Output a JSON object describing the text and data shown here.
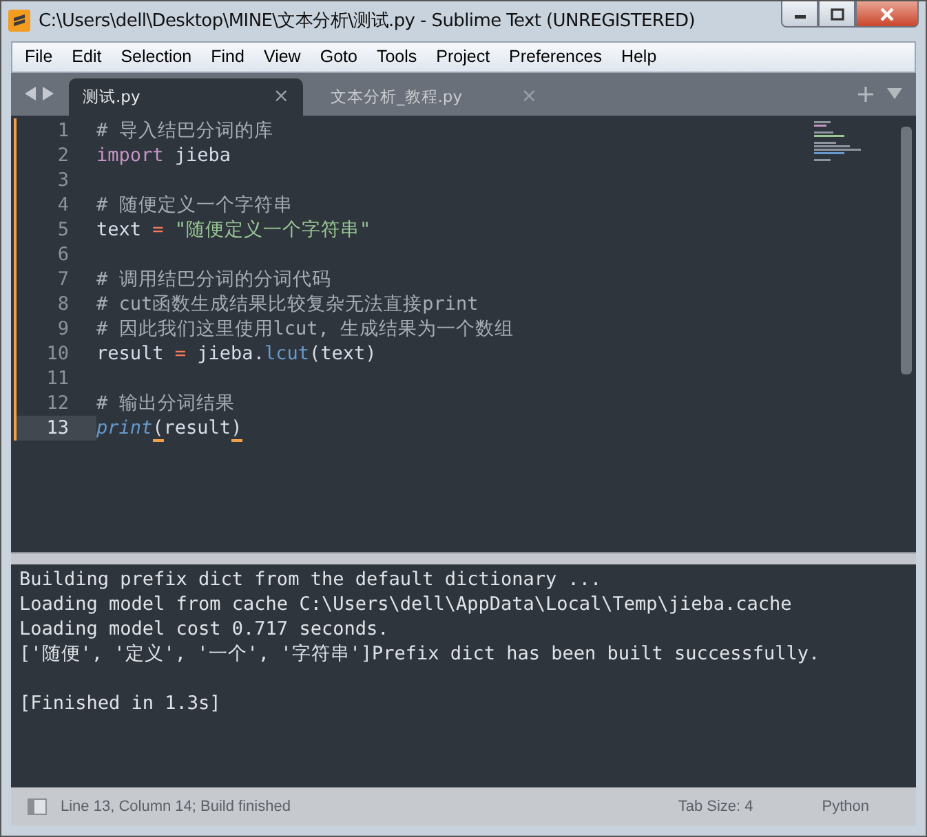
{
  "window": {
    "title": "C:\\Users\\dell\\Desktop\\MINE\\文本分析\\测试.py - Sublime Text (UNREGISTERED)"
  },
  "menu": [
    "File",
    "Edit",
    "Selection",
    "Find",
    "View",
    "Goto",
    "Tools",
    "Project",
    "Preferences",
    "Help"
  ],
  "tabs": [
    {
      "label": "测试.py",
      "selected": true,
      "close": "×"
    },
    {
      "label": "文本分析_教程.py",
      "selected": false,
      "close": "×"
    }
  ],
  "editor": {
    "lines": [
      {
        "number": "1",
        "modified": true,
        "current": false,
        "tokens": [
          {
            "kind": "comment",
            "text": "# 导入结巴分词的库"
          }
        ]
      },
      {
        "number": "2",
        "modified": true,
        "current": false,
        "tokens": [
          {
            "kind": "keyword",
            "text": "import"
          },
          {
            "kind": "plain",
            "text": " jieba"
          }
        ]
      },
      {
        "number": "3",
        "modified": true,
        "current": false
      },
      {
        "number": "4",
        "modified": true,
        "current": false,
        "tokens": [
          {
            "kind": "comment",
            "text": "# 随便定义一个字符串"
          }
        ]
      },
      {
        "number": "5",
        "modified": true,
        "current": false,
        "tokens": [
          {
            "kind": "plain",
            "text": "text "
          },
          {
            "kind": "operator",
            "text": "="
          },
          {
            "kind": "string",
            "text": " \"随便定义一个字符串\""
          }
        ]
      },
      {
        "number": "6",
        "modified": true,
        "current": false
      },
      {
        "number": "7",
        "modified": true,
        "current": false,
        "tokens": [
          {
            "kind": "comment",
            "text": "# 调用结巴分词的分词代码"
          }
        ]
      },
      {
        "number": "8",
        "modified": true,
        "current": false,
        "tokens": [
          {
            "kind": "comment",
            "text": "# cut函数生成结果比较复杂无法直接print"
          }
        ]
      },
      {
        "number": "9",
        "modified": true,
        "current": false,
        "tokens": [
          {
            "kind": "comment",
            "text": "# 因此我们这里使用lcut, 生成结果为一个数组"
          }
        ]
      },
      {
        "number": "10",
        "modified": true,
        "current": false,
        "tokens": [
          {
            "kind": "plain",
            "text": "result "
          },
          {
            "kind": "operator",
            "text": "="
          },
          {
            "kind": "plain",
            "text": " jieba."
          },
          {
            "kind": "method",
            "text": "lcut"
          },
          {
            "kind": "plain",
            "text": "(text)"
          }
        ]
      },
      {
        "number": "11",
        "modified": true,
        "current": false
      },
      {
        "number": "12",
        "modified": true,
        "current": false,
        "tokens": [
          {
            "kind": "comment",
            "text": "# 输出分词结果"
          }
        ]
      },
      {
        "number": "13",
        "modified": true,
        "current": true,
        "tokens": [
          {
            "kind": "builtin",
            "text": "print"
          },
          {
            "kind": "bracket",
            "text": "("
          },
          {
            "kind": "plain",
            "text": "result"
          },
          {
            "kind": "bracket",
            "text": ")"
          }
        ]
      }
    ]
  },
  "output": [
    {
      "text": "Building prefix dict from the default dictionary ...",
      "gap_before": false
    },
    {
      "text": "Loading model from cache C:\\Users\\dell\\AppData\\Local\\Temp\\jieba.cache",
      "gap_before": false
    },
    {
      "text": "Loading model cost 0.717 seconds.",
      "gap_before": false
    },
    {
      "text": "['随便', '定义', '一个', '字符串']Prefix dict has been built successfully.",
      "gap_before": false
    },
    {
      "text": "[Finished in 1.3s]",
      "gap_before": true
    }
  ],
  "status_bar": {
    "position": "Line 13, Column 14; Build finished",
    "tab_size": "Tab Size: 4",
    "syntax": "Python"
  }
}
